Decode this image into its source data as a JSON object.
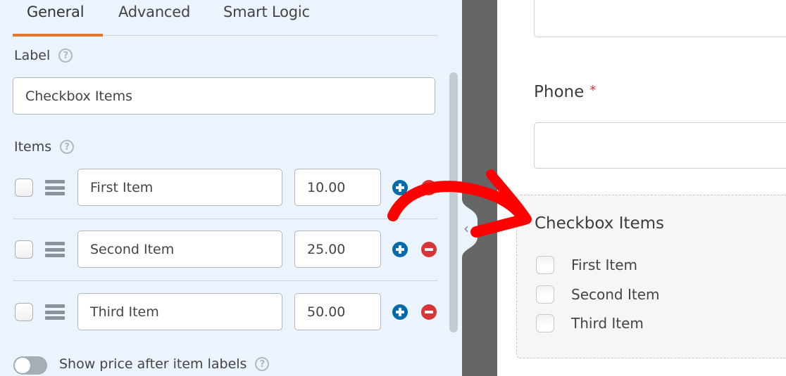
{
  "tabs": [
    {
      "label": "General",
      "active": true
    },
    {
      "label": "Advanced",
      "active": false
    },
    {
      "label": "Smart Logic",
      "active": false
    }
  ],
  "label_field": {
    "label": "Label",
    "value": "Checkbox Items"
  },
  "items_section": {
    "label": "Items",
    "items": [
      {
        "name": "First Item",
        "price": "10.00",
        "checked": false
      },
      {
        "name": "Second Item",
        "price": "25.00",
        "checked": false
      },
      {
        "name": "Third Item",
        "price": "50.00",
        "checked": false
      }
    ]
  },
  "show_price_toggle": {
    "label": "Show price after item labels",
    "enabled": false
  },
  "icons": {
    "help": "?",
    "collapse": "‹"
  },
  "preview": {
    "phone_label": "Phone",
    "required_marker": "*",
    "checkbox_field": {
      "title": "Checkbox Items",
      "choices": [
        "First Item",
        "Second Item",
        "Third Item"
      ]
    }
  },
  "colors": {
    "accent_tab": "#e27730",
    "add": "#036aab",
    "remove": "#d63638",
    "annotation": "#ff0000"
  }
}
